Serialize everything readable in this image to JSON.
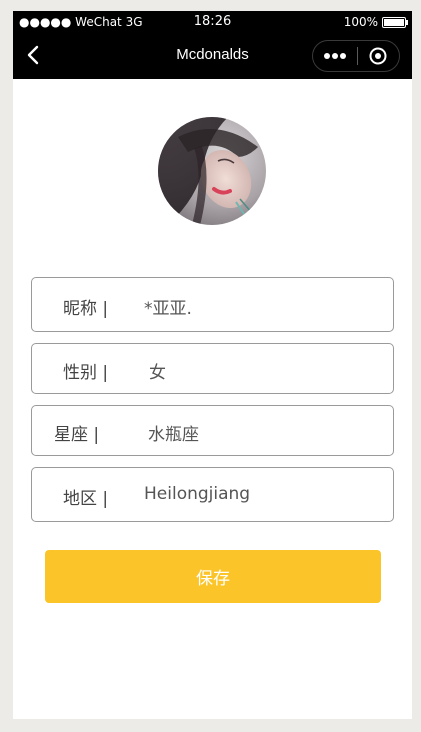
{
  "status_bar": {
    "signal": "●●●●● WeChat 3G",
    "time": "18:26",
    "battery": "100%"
  },
  "navbar": {
    "title": "Mcdonalds",
    "icons": [
      "back-icon",
      "more-icon",
      "close-mini-program-icon"
    ]
  },
  "profile": {
    "avatar_icon": "avatar-photo",
    "fields": [
      {
        "label": "昵称 |",
        "value": "*亚亚."
      },
      {
        "label": "性别 |",
        "value": "女"
      },
      {
        "label": "星座 |",
        "value": "水瓶座"
      },
      {
        "label": "地区 |",
        "value": "Heilongjiang"
      }
    ]
  },
  "save_label": "保存",
  "colors": {
    "accent": "#fbc52a",
    "navbar": "#000000",
    "border": "#9a9a9a"
  }
}
